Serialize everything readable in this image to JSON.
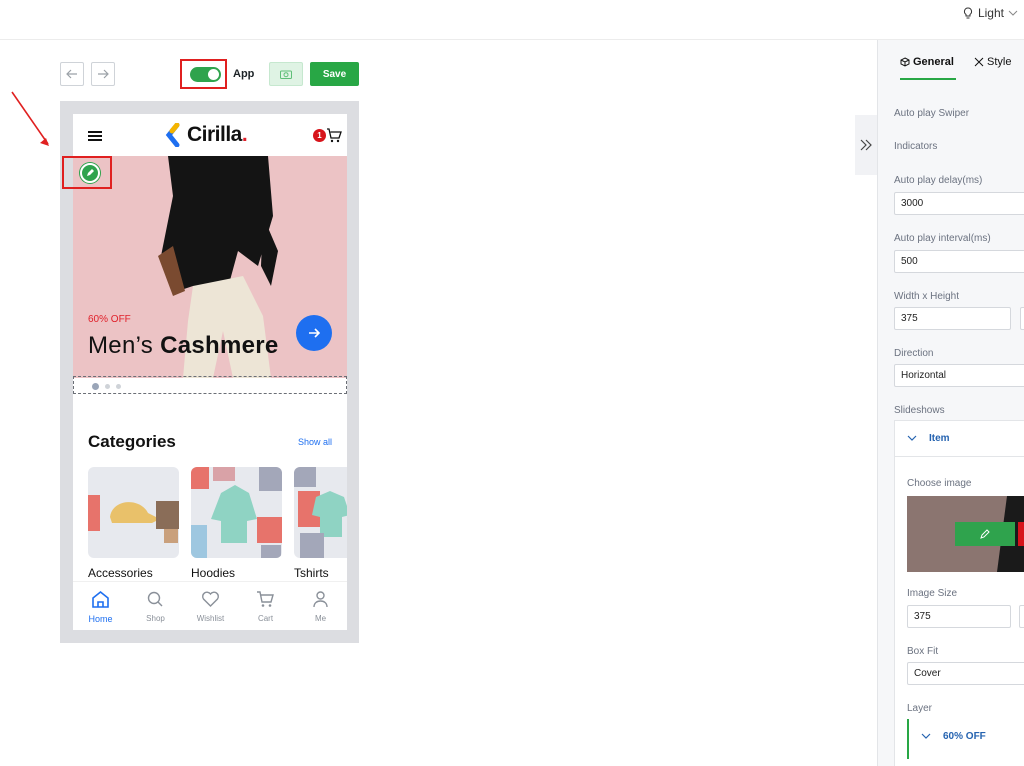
{
  "topbar": {
    "theme_label": "Light",
    "theme_icon": "bulb-icon"
  },
  "toolbar": {
    "back_icon": "arrow-left-icon",
    "forward_icon": "arrow-right-icon",
    "toggle_label": "App",
    "toggle_on": true,
    "screenshot_icon": "camera-icon",
    "save_label": "Save",
    "accent": "#28a745"
  },
  "preview": {
    "brand": "Cirilla",
    "cart_count": "1",
    "hero": {
      "subtitle": "60% OFF",
      "title_light": "Men’s",
      "title_bold": "Cashmere"
    },
    "categories": {
      "title": "Categories",
      "show_all": "Show all",
      "items": [
        {
          "label": "Accessories"
        },
        {
          "label": "Hoodies"
        },
        {
          "label": "Tshirts"
        }
      ]
    },
    "bottom_nav": [
      {
        "label": "Home",
        "icon": "home-icon",
        "active": true
      },
      {
        "label": "Shop",
        "icon": "search-icon",
        "active": false
      },
      {
        "label": "Wishlist",
        "icon": "heart-icon",
        "active": false
      },
      {
        "label": "Cart",
        "icon": "cart-icon",
        "active": false
      },
      {
        "label": "Me",
        "icon": "user-icon",
        "active": false
      }
    ]
  },
  "panel": {
    "tabs": [
      {
        "label": "General",
        "icon": "cube-icon"
      },
      {
        "label": "Style",
        "icon": "tools-icon"
      }
    ],
    "fields": {
      "autoplay_swiper": "Auto play Swiper",
      "indicators": "Indicators",
      "autoplay_delay_label": "Auto play delay(ms)",
      "autoplay_delay_value": "3000",
      "autoplay_interval_label": "Auto play interval(ms)",
      "autoplay_interval_value": "500",
      "size_label": "Width x Height",
      "width_value": "375",
      "direction_label": "Direction",
      "direction_value": "Horizontal",
      "slideshows_label": "Slideshows"
    },
    "item": {
      "title": "Item",
      "choose_image": "Choose image",
      "image_size_label": "Image Size",
      "image_size_value": "375",
      "box_fit_label": "Box Fit",
      "box_fit_value": "Cover",
      "layer_label": "Layer",
      "layer_item": "60% OFF"
    }
  }
}
